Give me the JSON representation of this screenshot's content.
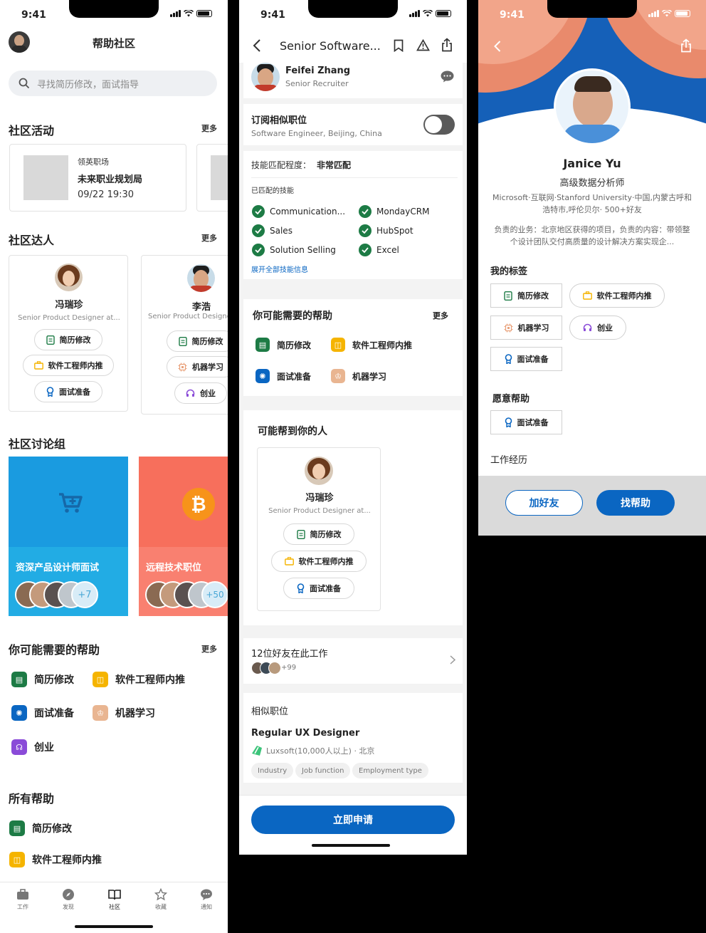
{
  "status_time": "9:41",
  "colors": {
    "accent": "#0a66c2",
    "green": "#1d7b45",
    "yellow": "#f5b400",
    "blue_icon": "#0a66c2",
    "peach": "#e9b591",
    "purple": "#8a4bd8",
    "group1": "#1fa8e0",
    "group2": "#f76f5c"
  },
  "screen1": {
    "title": "帮助社区",
    "search_placeholder": "寻找简历修改，面试指导",
    "activities": {
      "title": "社区活动",
      "more": "更多",
      "card": {
        "org": "领英职场",
        "name": "未来职业规划局",
        "time": "09/22 19:30"
      }
    },
    "experts": {
      "title": "社区达人",
      "more": "更多",
      "items": [
        {
          "name": "冯瑞珍",
          "role": "Senior Product Designer at...",
          "tags": [
            "简历修改",
            "软件工程师内推",
            "面试准备"
          ]
        },
        {
          "name": "李浩",
          "role": "Senior Product Designe",
          "tags": [
            "简历修改",
            "机器学习",
            "创业"
          ]
        }
      ]
    },
    "groups": {
      "title": "社区讨论组",
      "items": [
        {
          "name": "资深产品设计师面试",
          "count": "+7"
        },
        {
          "name": "远程技术职位",
          "count": "+50"
        }
      ]
    },
    "may_need": {
      "title": "你可能需要的帮助",
      "more": "更多",
      "items": [
        "简历修改",
        "软件工程师内推",
        "面试准备",
        "机器学习",
        "创业"
      ]
    },
    "all_help": {
      "title": "所有帮助",
      "items": [
        "简历修改",
        "软件工程师内推"
      ]
    },
    "tabs": [
      "工作",
      "发现",
      "社区",
      "收藏",
      "通知"
    ]
  },
  "screen2": {
    "title": "Senior Software...",
    "recruiter": {
      "name": "Feifei Zhang",
      "role": "Senior Recruiter"
    },
    "subscribe": {
      "title": "订阅相似职位",
      "subtitle": "Software Engineer, Beijing, China"
    },
    "skills": {
      "match_label": "技能匹配程度：",
      "match_value": "非常匹配",
      "matched_title": "已匹配的技能",
      "left": [
        "Communication...",
        "Sales",
        "Solution Selling"
      ],
      "right": [
        "MondayCRM",
        "HubSpot",
        "Excel"
      ],
      "expand": "展开全部技能信息"
    },
    "may_need": {
      "title": "你可能需要的帮助",
      "more": "更多",
      "items": [
        "简历修改",
        "软件工程师内推",
        "面试准备",
        "机器学习"
      ]
    },
    "helpers": {
      "title": "可能帮到你的人",
      "name": "冯瑞珍",
      "role": "Senior Product Designer at...",
      "tags": [
        "简历修改",
        "软件工程师内推",
        "面试准备"
      ]
    },
    "friends": {
      "text": "12位好友在此工作",
      "count": "+99"
    },
    "similar": {
      "title": "相似职位",
      "job": "Regular UX Designer",
      "company": "Luxsoft(10,000人以上) · 北京",
      "tags": [
        "Industry",
        "Job function",
        "Employment type"
      ]
    },
    "apply": "立即申请"
  },
  "screen3": {
    "name": "Janice Yu",
    "title": "高级数据分析师",
    "meta": "Microsoft·互联网·Stanford University·中国,内蒙古呼和浩特市,呼伦贝尔· 500+好友",
    "bio": "负责的业务：北京地区获得的项目，负责的内容：带领整个设计团队交付高质量的设计解决方案实现企...",
    "tags_title": "我的标签",
    "tags": [
      "简历修改",
      "软件工程师内推",
      "机器学习",
      "创业",
      "面试准备"
    ],
    "willing_title": "愿意帮助",
    "willing": [
      "面试准备"
    ],
    "work_title": "工作经历",
    "add_friend": "加好友",
    "find_help": "找帮助"
  }
}
